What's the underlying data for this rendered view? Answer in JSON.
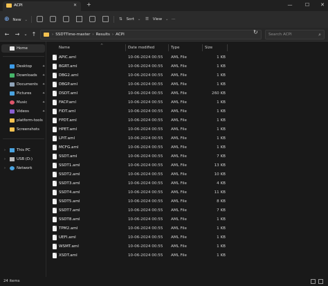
{
  "window": {
    "tab_title": "ACPI",
    "close_tab": "✕",
    "new_tab": "+",
    "minimize": "—",
    "maximize": "☐",
    "close": "✕"
  },
  "toolbar": {
    "new_label": "New",
    "sort_label": "Sort",
    "view_label": "View",
    "more_label": "···"
  },
  "address": {
    "crumbs": [
      "SSDTTime-master",
      "Results",
      "ACPI"
    ],
    "search_placeholder": "Search ACPI"
  },
  "sidebar": {
    "home": "Home",
    "pinned": [
      "Desktop",
      "Downloads",
      "Documents",
      "Pictures",
      "Music",
      "Videos",
      "platform-tools",
      "Screenshots"
    ],
    "drives": [
      "This PC",
      "USB (D:)",
      "Network"
    ]
  },
  "columns": {
    "name": "Name",
    "date": "Date modified",
    "type": "Type",
    "size": "Size"
  },
  "files": [
    {
      "name": "APIC.aml",
      "date": "10-06-2024 00:55",
      "type": "AML File",
      "size": "1 KB"
    },
    {
      "name": "BGRT.aml",
      "date": "10-06-2024 00:55",
      "type": "AML File",
      "size": "1 KB"
    },
    {
      "name": "DBG2.aml",
      "date": "10-06-2024 00:55",
      "type": "AML File",
      "size": "1 KB"
    },
    {
      "name": "DBGP.aml",
      "date": "10-06-2024 00:55",
      "type": "AML File",
      "size": "1 KB"
    },
    {
      "name": "DSDT.aml",
      "date": "10-06-2024 00:55",
      "type": "AML File",
      "size": "260 KB"
    },
    {
      "name": "FACP.aml",
      "date": "10-06-2024 00:55",
      "type": "AML File",
      "size": "1 KB"
    },
    {
      "name": "FIDT.aml",
      "date": "10-06-2024 00:55",
      "type": "AML File",
      "size": "1 KB"
    },
    {
      "name": "FPDT.aml",
      "date": "10-06-2024 00:55",
      "type": "AML File",
      "size": "1 KB"
    },
    {
      "name": "HPET.aml",
      "date": "10-06-2024 00:55",
      "type": "AML File",
      "size": "1 KB"
    },
    {
      "name": "LPIT.aml",
      "date": "10-06-2024 00:55",
      "type": "AML File",
      "size": "1 KB"
    },
    {
      "name": "MCFG.aml",
      "date": "10-06-2024 00:55",
      "type": "AML File",
      "size": "1 KB"
    },
    {
      "name": "SSDT.aml",
      "date": "10-06-2024 00:55",
      "type": "AML File",
      "size": "7 KB"
    },
    {
      "name": "SSDT1.aml",
      "date": "10-06-2024 00:55",
      "type": "AML File",
      "size": "13 KB"
    },
    {
      "name": "SSDT2.aml",
      "date": "10-06-2024 00:55",
      "type": "AML File",
      "size": "10 KB"
    },
    {
      "name": "SSDT3.aml",
      "date": "10-06-2024 00:55",
      "type": "AML File",
      "size": "4 KB"
    },
    {
      "name": "SSDT4.aml",
      "date": "10-06-2024 00:55",
      "type": "AML File",
      "size": "11 KB"
    },
    {
      "name": "SSDT5.aml",
      "date": "10-06-2024 00:55",
      "type": "AML File",
      "size": "8 KB"
    },
    {
      "name": "SSDT7.aml",
      "date": "10-06-2024 00:55",
      "type": "AML File",
      "size": "7 KB"
    },
    {
      "name": "SSDT8.aml",
      "date": "10-06-2024 00:55",
      "type": "AML File",
      "size": "1 KB"
    },
    {
      "name": "TPM2.aml",
      "date": "10-06-2024 00:55",
      "type": "AML File",
      "size": "1 KB"
    },
    {
      "name": "UEFI.aml",
      "date": "10-06-2024 00:55",
      "type": "AML File",
      "size": "1 KB"
    },
    {
      "name": "WSMT.aml",
      "date": "10-06-2024 00:55",
      "type": "AML File",
      "size": "1 KB"
    },
    {
      "name": "XSDT.aml",
      "date": "10-06-2024 00:55",
      "type": "AML File",
      "size": "1 KB"
    }
  ],
  "status": {
    "item_count": "24 items"
  },
  "colors": {
    "folder": "#f4c150",
    "accent": "#7eb6ff"
  }
}
